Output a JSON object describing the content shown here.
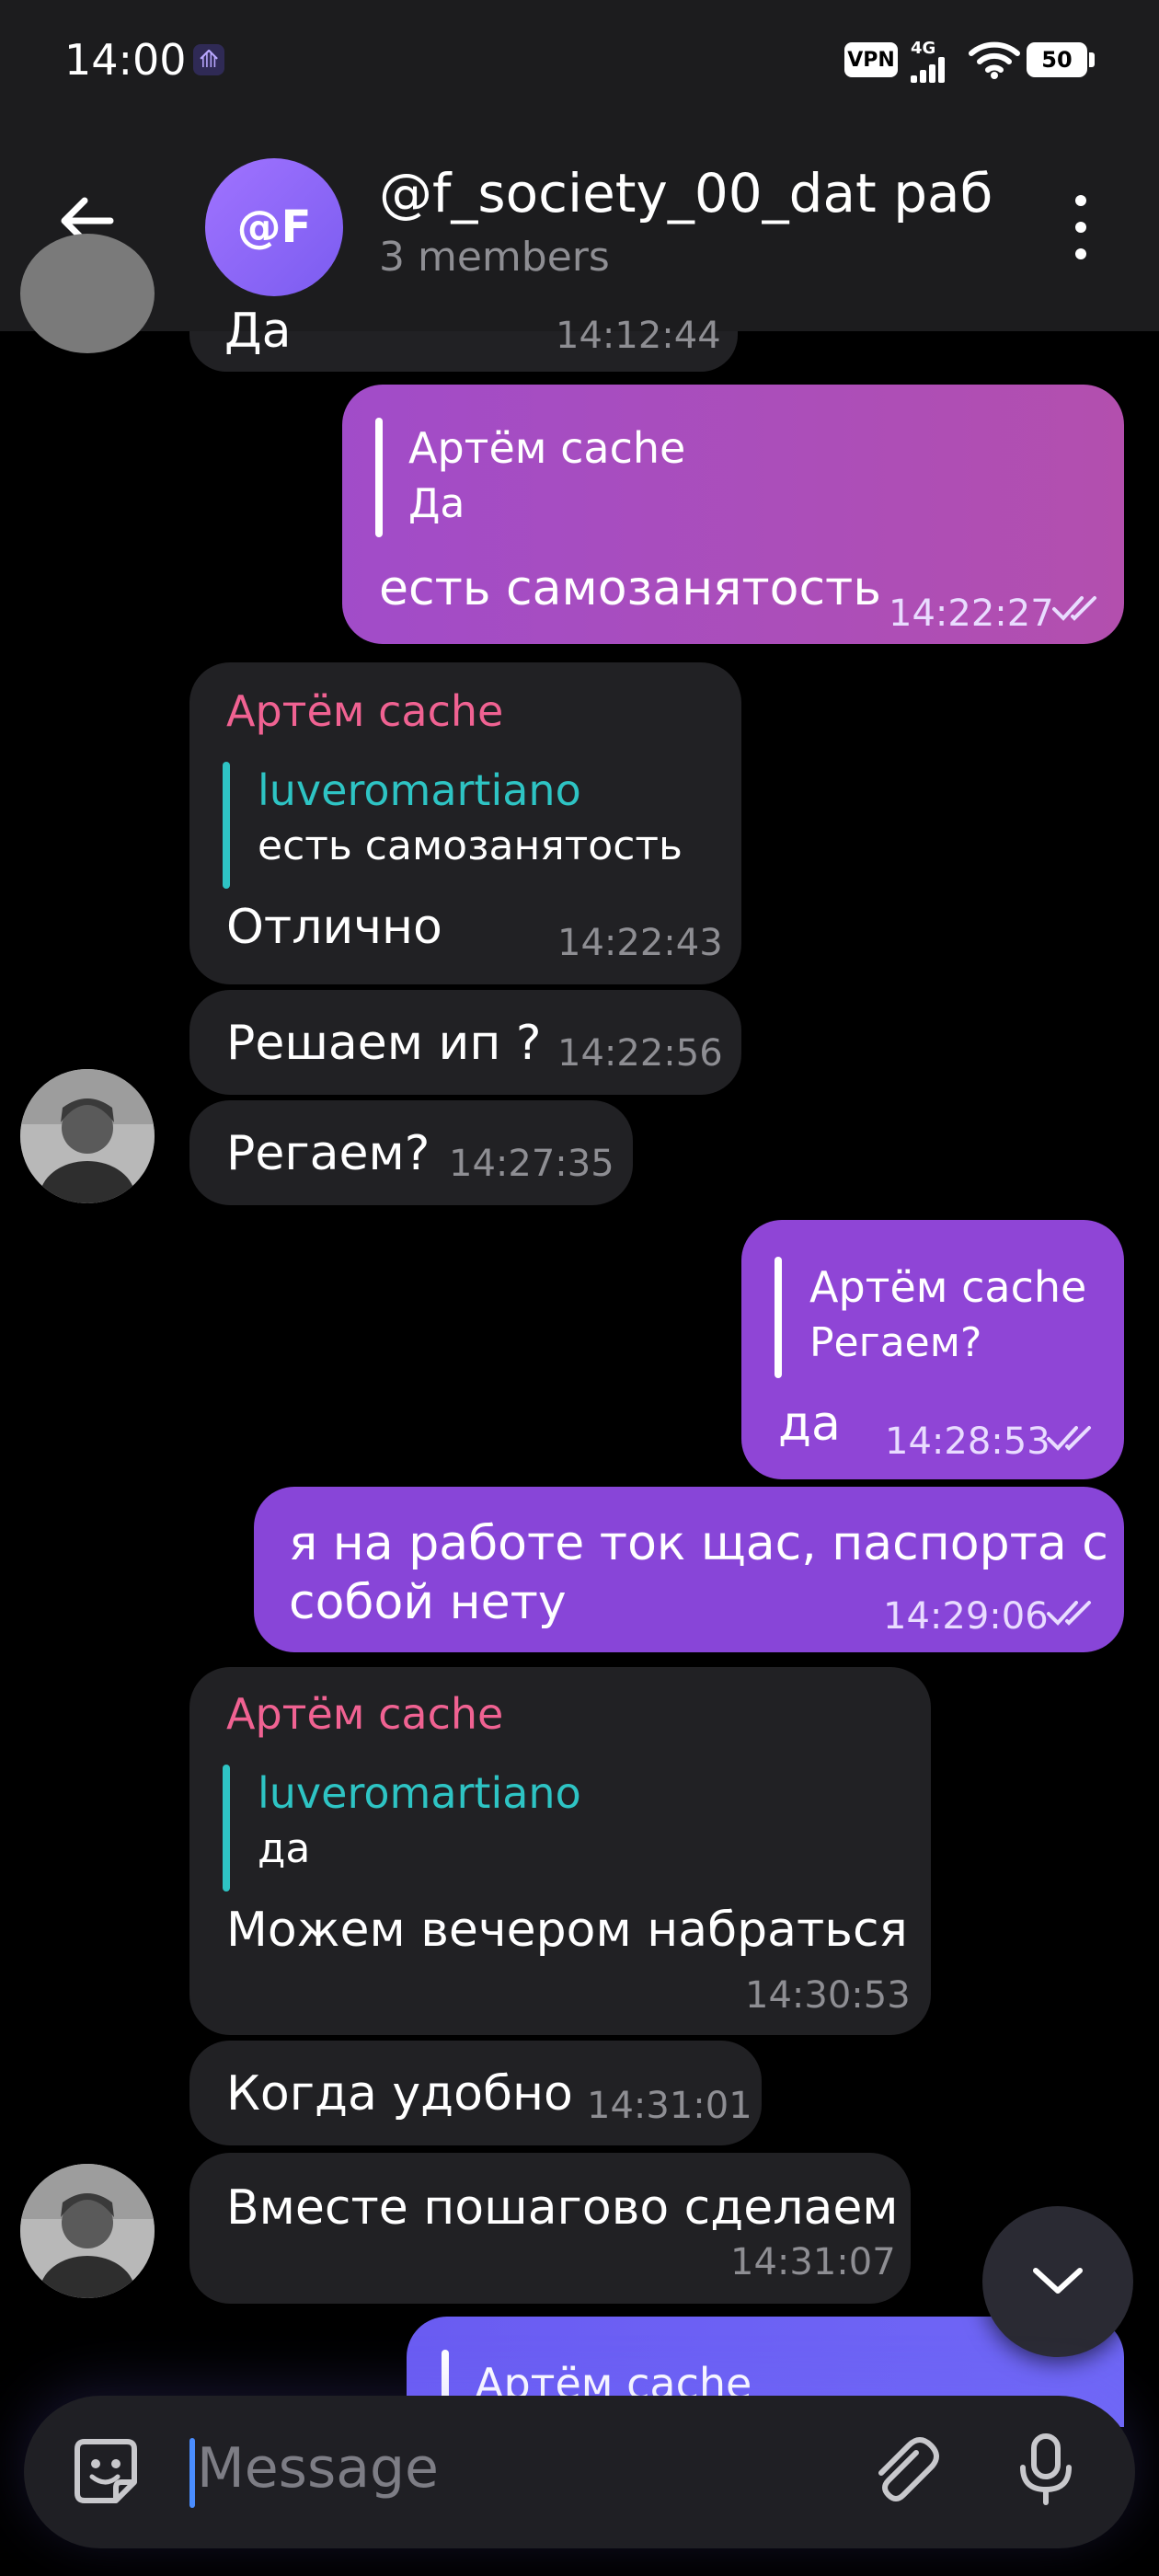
{
  "status_bar": {
    "time": "14:00",
    "vpn": "VPN",
    "network": "4G",
    "battery": "50"
  },
  "header": {
    "avatar_initials": "@F",
    "title": "@f_society_00_dat раб",
    "subtitle": "3 members",
    "avatar_color": "#9366f5"
  },
  "messages": [
    {
      "type": "incoming",
      "text": "Да",
      "time": "14:12:44"
    },
    {
      "type": "outgoing",
      "reply_to": {
        "name": "Артём cache",
        "text": "Да"
      },
      "text": "есть самозанятость",
      "time": "14:22:27"
    },
    {
      "type": "incoming",
      "sender": "Артём cache",
      "reply_to": {
        "name": "luveromartiano",
        "text": "есть самозанятость"
      },
      "text": "Отлично",
      "time": "14:22:43"
    },
    {
      "type": "incoming",
      "text": "Решаем ип ?",
      "time": "14:22:56"
    },
    {
      "type": "incoming",
      "text": "Регаем?",
      "time": "14:27:35"
    },
    {
      "type": "outgoing",
      "reply_to": {
        "name": "Артём cache",
        "text": "Регаем?"
      },
      "text": "да",
      "time": "14:28:53"
    },
    {
      "type": "outgoing",
      "text_line1": "я на работе ток щас, паспорта с",
      "text_line2": "собой нету",
      "time": "14:29:06"
    },
    {
      "type": "incoming",
      "sender": "Артём cache",
      "reply_to": {
        "name": "luveromartiano",
        "text": "да"
      },
      "text": "Можем вечером набраться",
      "time": "14:30:53"
    },
    {
      "type": "incoming",
      "text": "Когда удобно",
      "time": "14:31:01"
    },
    {
      "type": "incoming",
      "text": "Вместе пошагово сделаем",
      "time": "14:31:07"
    },
    {
      "type": "outgoing",
      "reply_to": {
        "name": "Артём cache"
      }
    }
  ],
  "input": {
    "placeholder": "Message"
  },
  "colors": {
    "incoming_bubble": "#212124",
    "outgoing_bubble": "#8a42d6",
    "sender_name": "#f06292",
    "reply_name_in": "#2ec4c4"
  }
}
